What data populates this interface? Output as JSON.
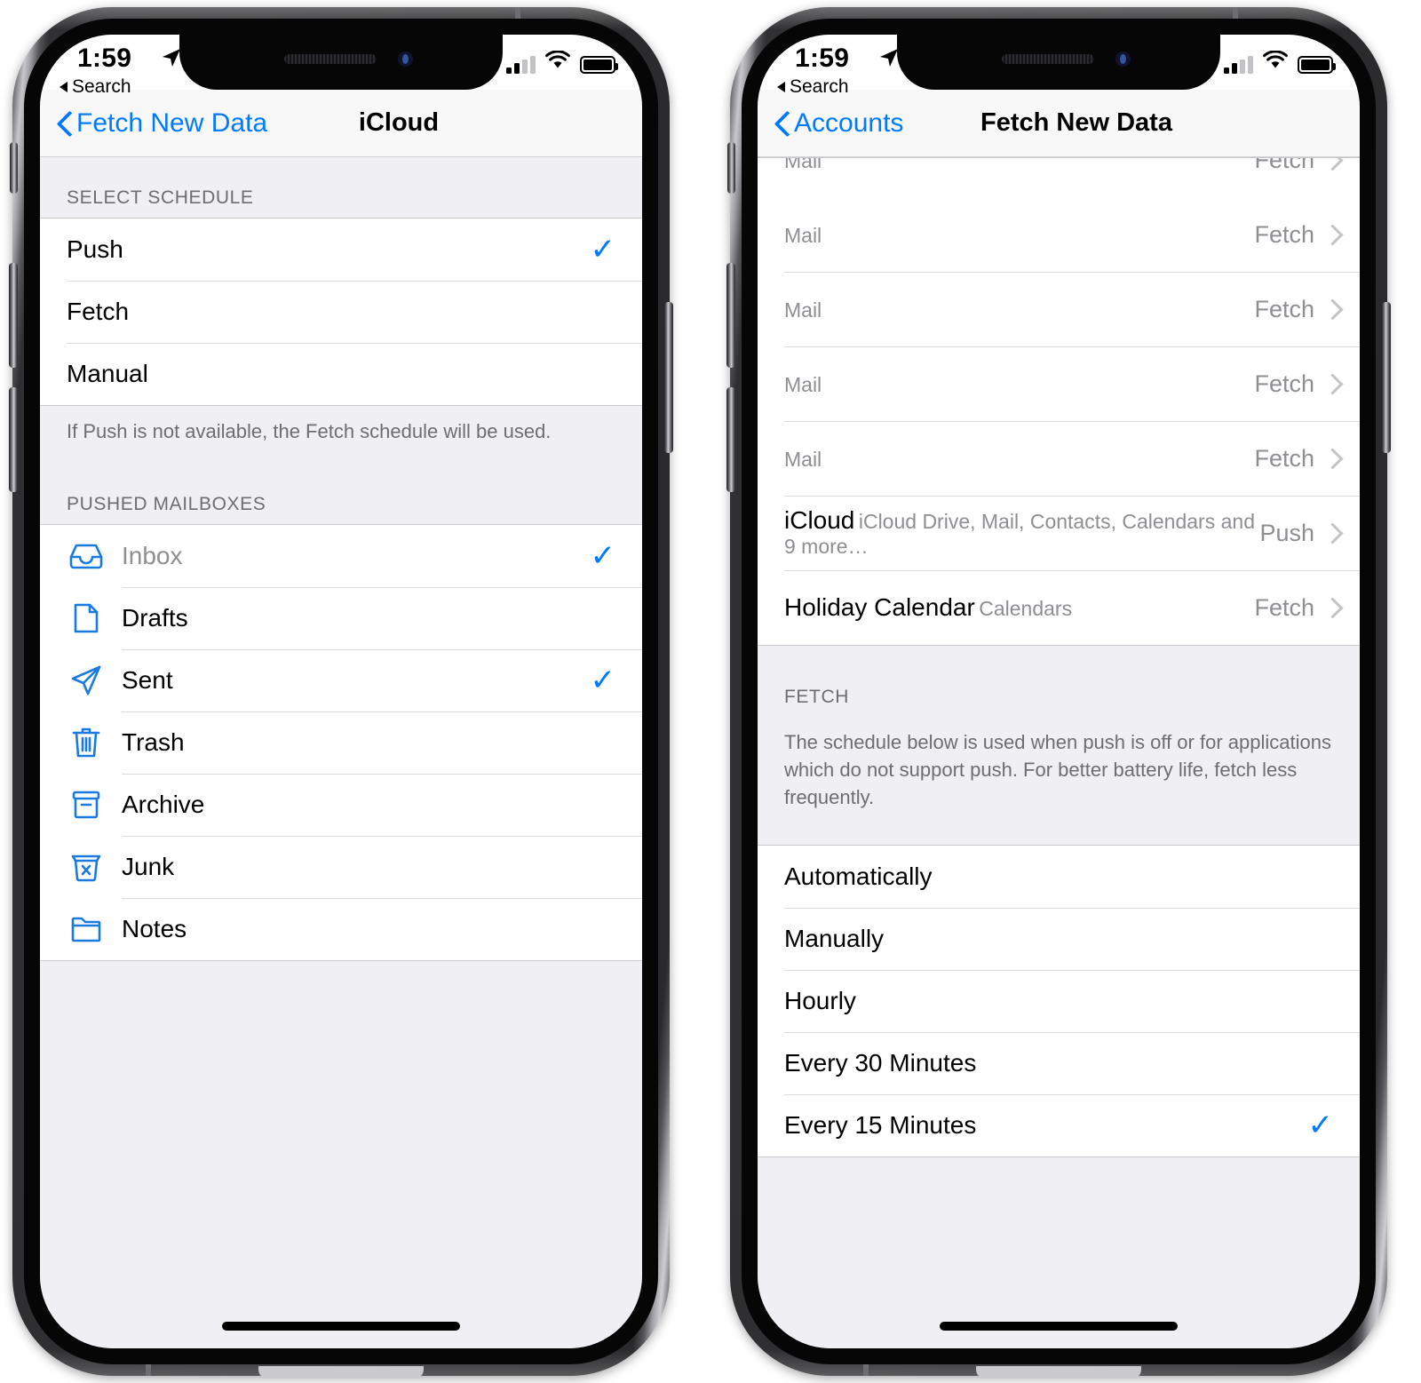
{
  "status_bar": {
    "time": "1:59",
    "back_label": "Search",
    "location_icon": "location-arrow-icon",
    "signal_icon": "cellular-signal-icon",
    "wifi_icon": "wifi-icon",
    "battery_icon": "battery-full-icon"
  },
  "accent_color": "#007aff",
  "left_phone": {
    "nav": {
      "back_label": "Fetch New Data",
      "title": "iCloud"
    },
    "schedule_section": {
      "header": "SELECT SCHEDULE",
      "footer": "If Push is not available, the Fetch schedule will be used.",
      "options": [
        {
          "label": "Push",
          "checked": true
        },
        {
          "label": "Fetch",
          "checked": false
        },
        {
          "label": "Manual",
          "checked": false
        }
      ]
    },
    "mailboxes_section": {
      "header": "PUSHED MAILBOXES",
      "items": [
        {
          "label": "Inbox",
          "icon": "inbox-tray-icon",
          "checked": true,
          "dimmed": true
        },
        {
          "label": "Drafts",
          "icon": "document-icon",
          "checked": false,
          "dimmed": false
        },
        {
          "label": "Sent",
          "icon": "paper-plane-icon",
          "checked": true,
          "dimmed": false
        },
        {
          "label": "Trash",
          "icon": "trash-can-icon",
          "checked": false,
          "dimmed": false
        },
        {
          "label": "Archive",
          "icon": "archive-box-icon",
          "checked": false,
          "dimmed": false
        },
        {
          "label": "Junk",
          "icon": "junk-trash-x-icon",
          "checked": false,
          "dimmed": false
        },
        {
          "label": "Notes",
          "icon": "folder-icon",
          "checked": false,
          "dimmed": false
        }
      ]
    }
  },
  "right_phone": {
    "nav": {
      "back_label": "Accounts",
      "title": "Fetch New Data"
    },
    "accounts": [
      {
        "title": "",
        "subtitle": "Mail",
        "value": "Fetch",
        "clipped": true
      },
      {
        "title": "",
        "subtitle": "Mail",
        "value": "Fetch",
        "clipped": false
      },
      {
        "title": "",
        "subtitle": "Mail",
        "value": "Fetch",
        "clipped": false
      },
      {
        "title": "",
        "subtitle": "Mail",
        "value": "Fetch",
        "clipped": false
      },
      {
        "title": "",
        "subtitle": "Mail",
        "value": "Fetch",
        "clipped": false
      },
      {
        "title": "iCloud",
        "subtitle": "iCloud Drive, Mail, Contacts, Calendars and 9 more…",
        "value": "Push",
        "clipped": false
      },
      {
        "title": "Holiday Calendar",
        "subtitle": "Calendars",
        "value": "Fetch",
        "clipped": false
      }
    ],
    "fetch_section": {
      "header": "FETCH",
      "description": "The schedule below is used when push is off or for applications which do not support push. For better battery life, fetch less frequently.",
      "options": [
        {
          "label": "Automatically",
          "checked": false
        },
        {
          "label": "Manually",
          "checked": false
        },
        {
          "label": "Hourly",
          "checked": false
        },
        {
          "label": "Every 30 Minutes",
          "checked": false
        },
        {
          "label": "Every 15 Minutes",
          "checked": true
        }
      ]
    }
  }
}
